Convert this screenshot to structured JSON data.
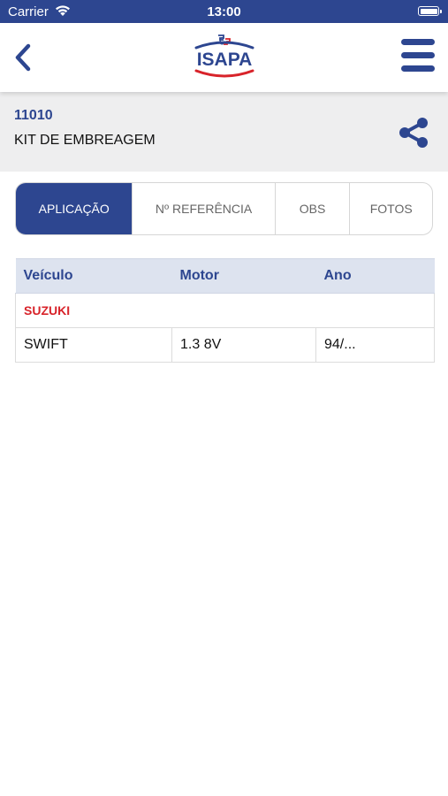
{
  "status": {
    "carrier": "Carrier",
    "time": "13:00"
  },
  "nav": {
    "logo_text": "ISAPA"
  },
  "product": {
    "code": "11010",
    "name": "KIT DE EMBREAGEM"
  },
  "tabs": [
    {
      "label": "APLICAÇÃO",
      "active": true
    },
    {
      "label": "Nº REFERÊNCIA",
      "active": false
    },
    {
      "label": "OBS",
      "active": false
    },
    {
      "label": "FOTOS",
      "active": false
    }
  ],
  "table": {
    "headers": [
      "Veículo",
      "Motor",
      "Ano"
    ],
    "brand": "SUZUKI",
    "rows": [
      {
        "vehicle": "SWIFT",
        "engine": "1.3 8V",
        "year": "94/..."
      }
    ]
  },
  "colors": {
    "primary": "#2d4690",
    "brand_red": "#d8232a",
    "header_bg": "#eeeeef"
  }
}
